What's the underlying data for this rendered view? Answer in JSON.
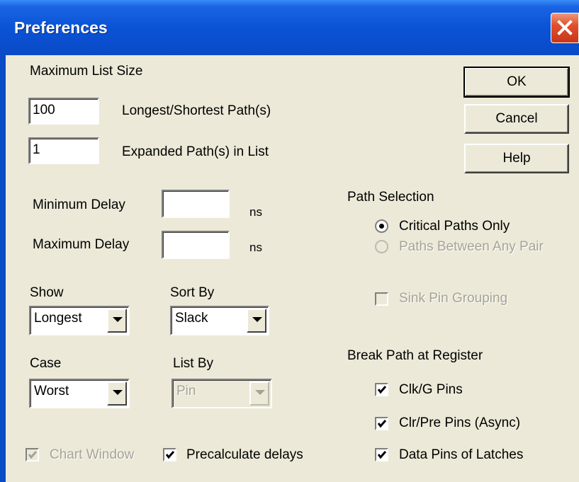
{
  "window": {
    "title": "Preferences"
  },
  "max_list": {
    "heading": "Maximum List Size",
    "longest_value": "100",
    "longest_label": "Longest/Shortest Path(s)",
    "expanded_value": "1",
    "expanded_label": "Expanded Path(s) in List"
  },
  "delay": {
    "min_label": "Minimum Delay",
    "min_value": "",
    "max_label": "Maximum Delay",
    "max_value": "",
    "unit": "ns"
  },
  "buttons": {
    "ok": "OK",
    "cancel": "Cancel",
    "help": "Help"
  },
  "path_selection": {
    "heading": "Path Selection",
    "option_critical": "Critical Paths Only",
    "option_any_pair": "Paths Between Any Pair",
    "selected": "Critical Paths Only",
    "sink_pin_grouping": "Sink Pin Grouping"
  },
  "show": {
    "label": "Show",
    "value": "Longest"
  },
  "sort_by": {
    "label": "Sort By",
    "value": "Slack"
  },
  "case": {
    "label": "Case",
    "value": "Worst"
  },
  "list_by": {
    "label": "List By",
    "value": "Pin"
  },
  "break_path": {
    "heading": "Break Path at Register",
    "clk_pins": "Clk/G Pins",
    "clr_pins": "Clr/Pre Pins (Async)",
    "data_pins": "Data Pins of Latches",
    "clk_checked": true,
    "clr_checked": true,
    "data_checked": true
  },
  "bottom": {
    "chart_window": "Chart Window",
    "chart_window_checked": true,
    "precalculate": "Precalculate delays",
    "precalculate_checked": true
  },
  "icons": [
    "close-icon",
    "dropdown-arrow-icon",
    "checkmark-icon",
    "radio-dot-icon"
  ]
}
